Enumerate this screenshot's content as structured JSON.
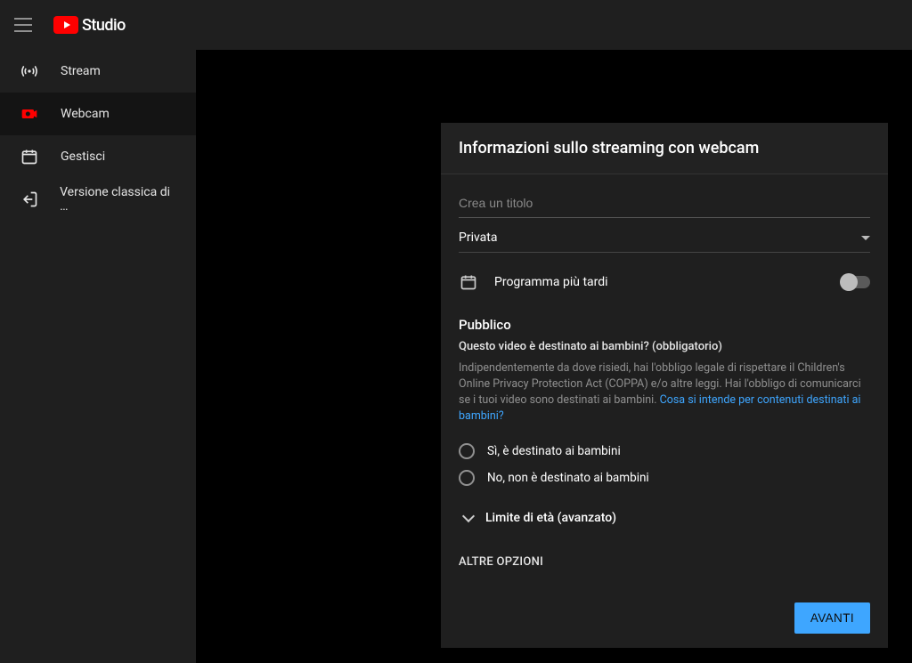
{
  "header": {
    "brand": "Studio"
  },
  "sidebar": {
    "items": [
      {
        "label": "Stream"
      },
      {
        "label": "Webcam"
      },
      {
        "label": "Gestisci"
      },
      {
        "label": "Versione classica di …"
      }
    ]
  },
  "panel": {
    "title": "Informazioni sullo streaming con webcam",
    "title_placeholder": "Crea un titolo",
    "privacy_value": "Privata",
    "schedule_label": "Programma più tardi",
    "audience_section": "Pubblico",
    "audience_question": "Questo video è destinato ai bambini? (obbligatorio)",
    "audience_desc": "Indipendentemente da dove risiedi, hai l'obbligo legale di rispettare il Children's Online Privacy Protection Act (COPPA) e/o altre leggi. Hai l'obbligo di comunicarci se i tuoi video sono destinati ai bambini. ",
    "audience_link": "Cosa si intende per contenuti destinati ai bambini?",
    "radio_yes": "Sì, è destinato ai bambini",
    "radio_no": "No, non è destinato ai bambini",
    "age_expander": "Limite di età (avanzato)",
    "more_options": "ALTRE OPZIONI",
    "next_button": "AVANTI"
  }
}
